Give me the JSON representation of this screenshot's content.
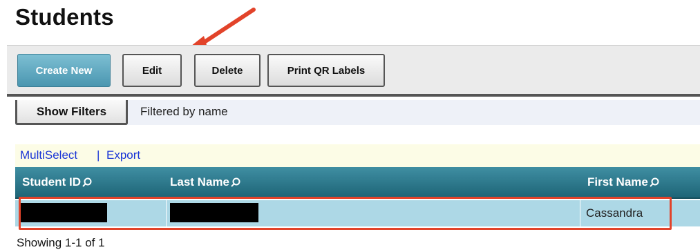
{
  "page": {
    "title": "Students"
  },
  "toolbar": {
    "create_new": "Create New",
    "edit": "Edit",
    "delete": "Delete",
    "print_qr": "Print QR Labels"
  },
  "filters": {
    "show_filters": "Show Filters",
    "filter_status": "Filtered by name"
  },
  "links": {
    "multiselect": "MultiSelect",
    "separator": "|",
    "export": "Export"
  },
  "table": {
    "columns": [
      "Student ID",
      "Last Name",
      "First Name"
    ],
    "rows": [
      {
        "student_id": "",
        "last_name": "",
        "first_name": "Cassandra"
      }
    ]
  },
  "footer": {
    "showing": "Showing 1-1 of 1"
  },
  "colors": {
    "accent_button": "#5aa5bf",
    "header": "#2a7486",
    "row": "#add8e6",
    "annotation": "#e2432a",
    "link": "#1a35d6"
  }
}
